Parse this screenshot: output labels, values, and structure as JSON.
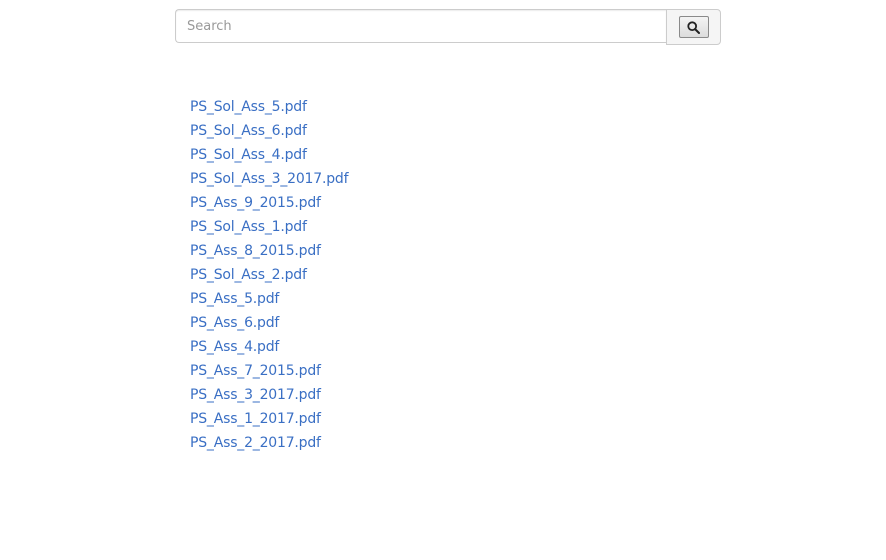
{
  "search": {
    "placeholder": "Search",
    "value": "",
    "button_icon": "search-icon"
  },
  "files": [
    "PS_Sol_Ass_5.pdf",
    "PS_Sol_Ass_6.pdf",
    "PS_Sol_Ass_4.pdf",
    "PS_Sol_Ass_3_2017.pdf",
    "PS_Ass_9_2015.pdf",
    "PS_Sol_Ass_1.pdf",
    "PS_Ass_8_2015.pdf",
    "PS_Sol_Ass_2.pdf",
    "PS_Ass_5.pdf",
    "PS_Ass_6.pdf",
    "PS_Ass_4.pdf",
    "PS_Ass_7_2015.pdf",
    "PS_Ass_3_2017.pdf",
    "PS_Ass_1_2017.pdf",
    "PS_Ass_2_2017.pdf"
  ],
  "colors": {
    "link": "#3a6fc4",
    "border": "#cccccc",
    "placeholder": "#999999"
  }
}
